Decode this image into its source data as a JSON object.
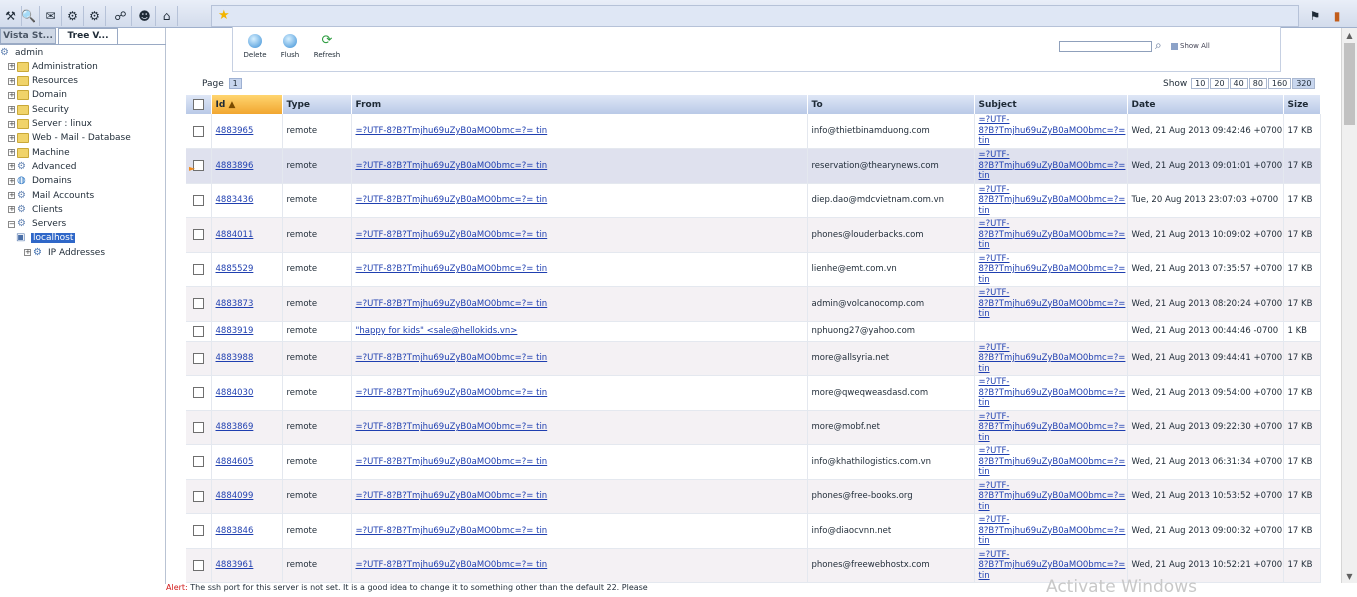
{
  "toolbar": {
    "left_icons": [
      "tools-icon",
      "search-doc-icon",
      "mail-tray-icon",
      "gear-network-icon",
      "gear-refresh-icon",
      "signal-icon",
      "user-lock-icon",
      "home-icon"
    ],
    "favorite_icon": "star-icon",
    "right_icons": [
      "pin-icon",
      "logout-door-icon"
    ]
  },
  "left_panel": {
    "tabs": [
      "Vista St...",
      "Tree V..."
    ],
    "tree": [
      {
        "label": "admin",
        "icon": "gear-icon"
      },
      {
        "label": "Administration",
        "icon": "folder-icon"
      },
      {
        "label": "Resources",
        "icon": "folder-icon"
      },
      {
        "label": "Domain",
        "icon": "folder-icon"
      },
      {
        "label": "Security",
        "icon": "folder-icon"
      },
      {
        "label": "Server : linux",
        "icon": "folder-icon"
      },
      {
        "label": "Web - Mail - Database",
        "icon": "folder-icon"
      },
      {
        "label": "Machine",
        "icon": "folder-icon"
      },
      {
        "label": "Advanced",
        "icon": "gear-icon"
      },
      {
        "label": "Domains",
        "icon": "globe-icon"
      },
      {
        "label": "Mail Accounts",
        "icon": "gear-icon"
      },
      {
        "label": "Clients",
        "icon": "gear-icon"
      },
      {
        "label": "Servers",
        "icon": "gear-icon"
      },
      {
        "label": "localhost",
        "icon": "server-icon"
      },
      {
        "label": "IP Addresses",
        "icon": "network-icon"
      }
    ]
  },
  "actions": {
    "delete": "Delete",
    "flush": "Flush",
    "refresh": "Refresh",
    "search_placeholder": "",
    "show_all": "Show All"
  },
  "pager": {
    "label": "Page",
    "current": "1",
    "show_label": "Show",
    "show_options": [
      "10",
      "20",
      "40",
      "80",
      "160",
      "320"
    ],
    "show_selected": "320"
  },
  "table": {
    "columns": [
      "Id",
      "Type",
      "From",
      "To",
      "Subject",
      "Date",
      "Size"
    ],
    "rows": [
      {
        "id": "4883965",
        "type": "remote",
        "from": "=?UTF-8?B?Tmjhu69uZyB0aMO0bmc=?= tin",
        "to": "info@thietbinamduong.com",
        "subject": "=?UTF-8?B?Tmjhu69uZyB0aMO0bmc=?= tin",
        "date": "Wed, 21 Aug 2013 09:42:46 +0700",
        "size": "17 KB"
      },
      {
        "id": "4883896",
        "type": "remote",
        "from": "=?UTF-8?B?Tmjhu69uZyB0aMO0bmc=?= tin",
        "to": "reservation@thearynews.com",
        "subject": "=?UTF-8?B?Tmjhu69uZyB0aMO0bmc=?= tin",
        "date": "Wed, 21 Aug 2013 09:01:01 +0700",
        "size": "17 KB"
      },
      {
        "id": "4883436",
        "type": "remote",
        "from": "=?UTF-8?B?Tmjhu69uZyB0aMO0bmc=?= tin",
        "to": "diep.dao@mdcvietnam.com.vn",
        "subject": "=?UTF-8?B?Tmjhu69uZyB0aMO0bmc=?= tin",
        "date": "Tue, 20 Aug 2013 23:07:03 +0700",
        "size": "17 KB"
      },
      {
        "id": "4884011",
        "type": "remote",
        "from": "=?UTF-8?B?Tmjhu69uZyB0aMO0bmc=?= tin",
        "to": "phones@louderbacks.com",
        "subject": "=?UTF-8?B?Tmjhu69uZyB0aMO0bmc=?= tin",
        "date": "Wed, 21 Aug 2013 10:09:02 +0700",
        "size": "17 KB"
      },
      {
        "id": "4885529",
        "type": "remote",
        "from": "=?UTF-8?B?Tmjhu69uZyB0aMO0bmc=?= tin",
        "to": "lienhe@emt.com.vn",
        "subject": "=?UTF-8?B?Tmjhu69uZyB0aMO0bmc=?= tin",
        "date": "Wed, 21 Aug 2013 07:35:57 +0700",
        "size": "17 KB"
      },
      {
        "id": "4883873",
        "type": "remote",
        "from": "=?UTF-8?B?Tmjhu69uZyB0aMO0bmc=?= tin",
        "to": "admin@volcanocomp.com",
        "subject": "=?UTF-8?B?Tmjhu69uZyB0aMO0bmc=?= tin",
        "date": "Wed, 21 Aug 2013 08:20:24 +0700",
        "size": "17 KB"
      },
      {
        "id": "4883919",
        "type": "remote",
        "from": "\"happy for kids\" <sale@hellokids.vn>",
        "to": "nphuong27@yahoo.com",
        "subject": "",
        "date": "Wed, 21 Aug 2013 00:44:46 -0700",
        "size": "1 KB"
      },
      {
        "id": "4883988",
        "type": "remote",
        "from": "=?UTF-8?B?Tmjhu69uZyB0aMO0bmc=?= tin",
        "to": "more@allsyria.net",
        "subject": "=?UTF-8?B?Tmjhu69uZyB0aMO0bmc=?= tin",
        "date": "Wed, 21 Aug 2013 09:44:41 +0700",
        "size": "17 KB"
      },
      {
        "id": "4884030",
        "type": "remote",
        "from": "=?UTF-8?B?Tmjhu69uZyB0aMO0bmc=?= tin",
        "to": "more@qweqweasdasd.com",
        "subject": "=?UTF-8?B?Tmjhu69uZyB0aMO0bmc=?= tin",
        "date": "Wed, 21 Aug 2013 09:54:00 +0700",
        "size": "17 KB"
      },
      {
        "id": "4883869",
        "type": "remote",
        "from": "=?UTF-8?B?Tmjhu69uZyB0aMO0bmc=?= tin",
        "to": "more@mobf.net",
        "subject": "=?UTF-8?B?Tmjhu69uZyB0aMO0bmc=?= tin",
        "date": "Wed, 21 Aug 2013 09:22:30 +0700",
        "size": "17 KB"
      },
      {
        "id": "4884605",
        "type": "remote",
        "from": "=?UTF-8?B?Tmjhu69uZyB0aMO0bmc=?= tin",
        "to": "info@khathilogistics.com.vn",
        "subject": "=?UTF-8?B?Tmjhu69uZyB0aMO0bmc=?= tin",
        "date": "Wed, 21 Aug 2013 06:31:34 +0700",
        "size": "17 KB"
      },
      {
        "id": "4884099",
        "type": "remote",
        "from": "=?UTF-8?B?Tmjhu69uZyB0aMO0bmc=?= tin",
        "to": "phones@free-books.org",
        "subject": "=?UTF-8?B?Tmjhu69uZyB0aMO0bmc=?= tin",
        "date": "Wed, 21 Aug 2013 10:53:52 +0700",
        "size": "17 KB"
      },
      {
        "id": "4883846",
        "type": "remote",
        "from": "=?UTF-8?B?Tmjhu69uZyB0aMO0bmc=?= tin",
        "to": "info@diaocvnn.net",
        "subject": "=?UTF-8?B?Tmjhu69uZyB0aMO0bmc=?= tin",
        "date": "Wed, 21 Aug 2013 09:00:32 +0700",
        "size": "17 KB"
      },
      {
        "id": "4883961",
        "type": "remote",
        "from": "=?UTF-8?B?Tmjhu69uZyB0aMO0bmc=?= tin",
        "to": "phones@freewebhostx.com",
        "subject": "=?UTF-8?B?Tmjhu69uZyB0aMO0bmc=?= tin",
        "date": "Wed, 21 Aug 2013 10:52:21 +0700",
        "size": "17 KB"
      }
    ]
  },
  "status": {
    "alert_label": "Alert:",
    "alert_text": "The ssh port for this server is not set. It is a good idea to change it to something other than the default 22. Please",
    "watermark": "Activate Windows"
  },
  "colors": {
    "header_sorted": "#f1a630",
    "header": "#b9c9e7",
    "link": "#1f3fb0",
    "alert": "#d11818",
    "selected_tree": "#2f67c8"
  }
}
